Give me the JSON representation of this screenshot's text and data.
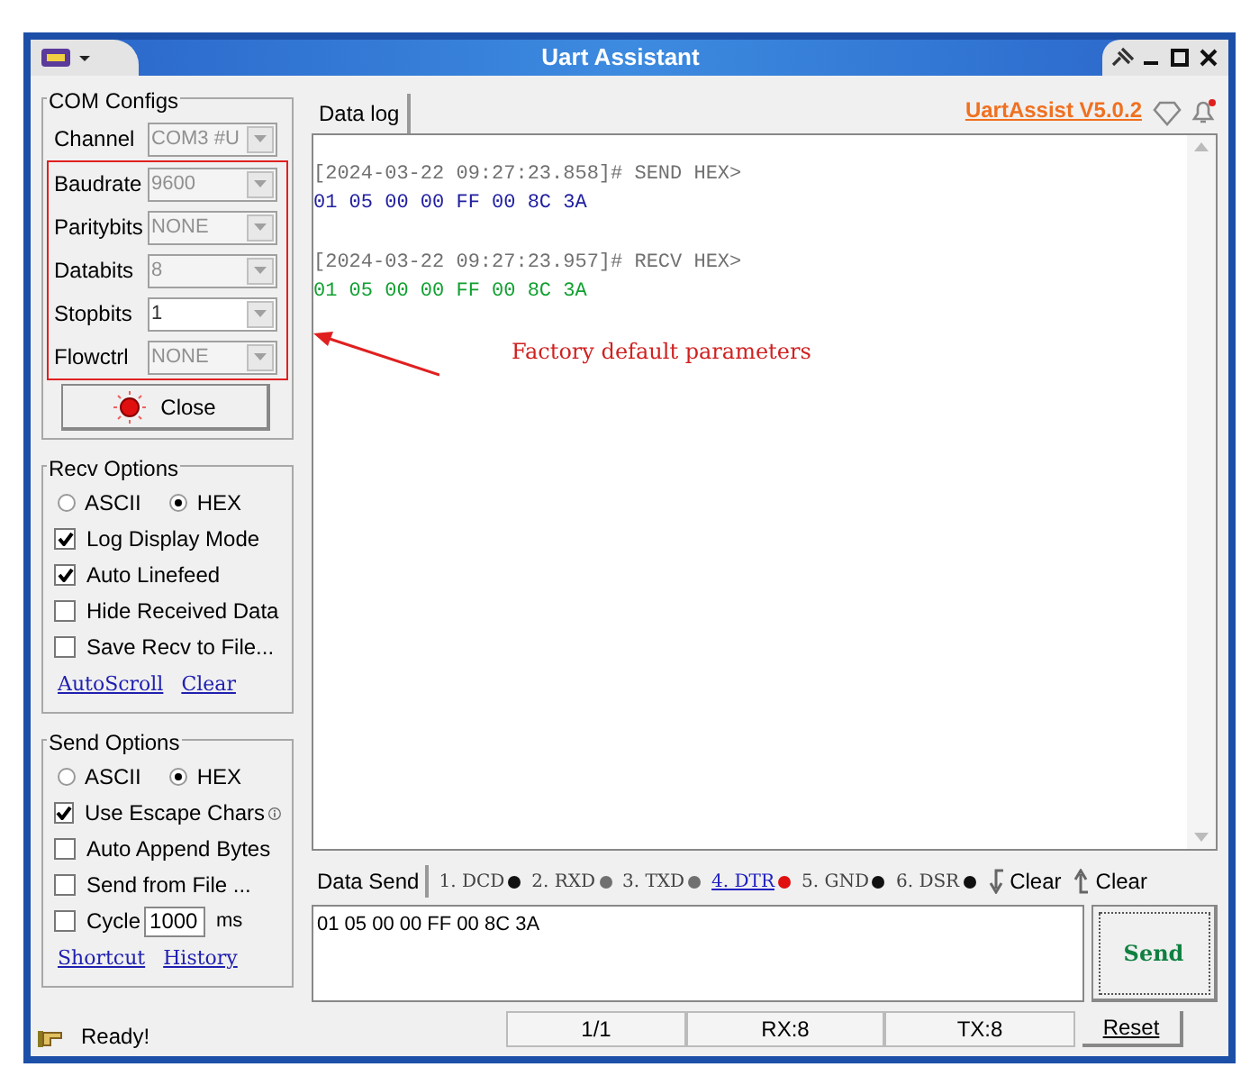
{
  "window": {
    "title": "Uart Assistant"
  },
  "com_configs": {
    "title": "COM Configs",
    "fields": [
      {
        "label": "Channel",
        "value": "COM3 #U",
        "disabled": true
      }
    ],
    "annotated_fields": [
      {
        "label": "Baudrate",
        "value": "9600",
        "disabled": true
      },
      {
        "label": "Paritybits",
        "value": "NONE",
        "disabled": true
      },
      {
        "label": "Databits",
        "value": "8",
        "disabled": true
      },
      {
        "label": "Stopbits",
        "value": "1",
        "disabled": false
      },
      {
        "label": "Flowctrl",
        "value": "NONE",
        "disabled": true
      }
    ],
    "close_button": "Close"
  },
  "recv_options": {
    "title": "Recv Options",
    "modes": [
      {
        "label": "ASCII",
        "selected": false
      },
      {
        "label": "HEX",
        "selected": true
      }
    ],
    "checks": [
      {
        "label": "Log Display Mode",
        "checked": true
      },
      {
        "label": "Auto Linefeed",
        "checked": true
      },
      {
        "label": "Hide Received Data",
        "checked": false
      },
      {
        "label": "Save Recv to File...",
        "checked": false
      }
    ],
    "links": [
      "AutoScroll",
      "Clear"
    ]
  },
  "send_options": {
    "title": "Send Options",
    "modes": [
      {
        "label": "ASCII",
        "selected": false
      },
      {
        "label": "HEX",
        "selected": true
      }
    ],
    "checks": [
      {
        "label": "Use Escape Chars",
        "checked": true,
        "info": true
      },
      {
        "label": "Auto Append Bytes",
        "checked": false
      },
      {
        "label": "Send from File ...",
        "checked": false
      },
      {
        "label": "Cycle",
        "checked": false,
        "value": "1000",
        "unit": "ms"
      }
    ],
    "links": [
      "Shortcut",
      "History"
    ]
  },
  "data_log": {
    "tab": "Data log",
    "version_link": "UartAssist V5.0.2",
    "entries": [
      {
        "header": "[2024-03-22 09:27:23.858]# SEND HEX>",
        "data": "01 05 00 00 FF 00 8C 3A",
        "kind": "send"
      },
      {
        "header": "[2024-03-22 09:27:23.957]# RECV HEX>",
        "data": "01 05 00 00 FF 00 8C 3A",
        "kind": "recv"
      }
    ],
    "annotation": "Factory default parameters"
  },
  "data_send": {
    "tab": "Data Send",
    "pins": [
      {
        "label": "1. DCD",
        "color": "#111111",
        "active": false
      },
      {
        "label": "2. RXD",
        "color": "#707070",
        "active": false
      },
      {
        "label": "3. TXD",
        "color": "#707070",
        "active": false
      },
      {
        "label": "4. DTR",
        "color": "#e01010",
        "active": true
      },
      {
        "label": "5. GND",
        "color": "#111111",
        "active": false
      },
      {
        "label": "6. DSR",
        "color": "#111111",
        "active": false
      }
    ],
    "clear_buttons": [
      "Clear",
      "Clear"
    ],
    "value": "01 05 00 00 FF 00 8C 3A",
    "send_button": "Send"
  },
  "status_bar": {
    "status": "Ready!",
    "page": "1/1",
    "rx": "RX:8",
    "tx": "TX:8",
    "reset": "Reset"
  }
}
